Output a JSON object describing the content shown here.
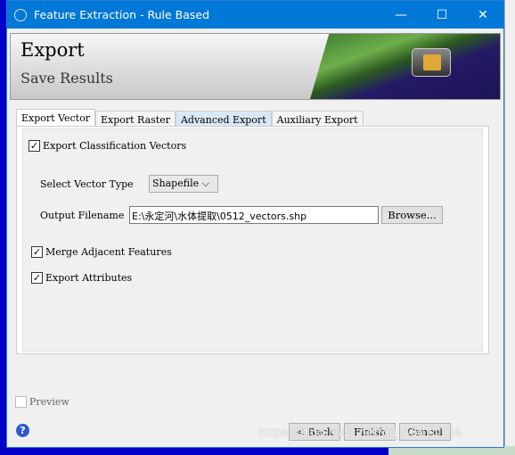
{
  "window": {
    "title": "Feature Extraction - Rule Based",
    "minimize": "—",
    "maximize": "☐",
    "close": "✕"
  },
  "banner": {
    "title": "Export",
    "subtitle": "Save Results"
  },
  "tabs": [
    {
      "label": "Export Vector",
      "active": true
    },
    {
      "label": "Export Raster"
    },
    {
      "label": "Advanced Export"
    },
    {
      "label": "Auxiliary Export"
    }
  ],
  "form": {
    "export_classification_vectors": {
      "label": "Export Classification Vectors",
      "checked": true
    },
    "vector_type": {
      "label": "Select Vector Type",
      "value": "Shapefile ⌵"
    },
    "output_filename": {
      "label": "Output Filename",
      "value": "E:\\永定河\\水体提取\\0512_vectors.shp",
      "browse": "Browse..."
    },
    "merge_adjacent": {
      "label": "Merge Adjacent Features",
      "checked": true
    },
    "export_attributes": {
      "label": "Export Attributes",
      "checked": true
    }
  },
  "preview": {
    "label": "Preview",
    "checked": false
  },
  "buttons": {
    "back": "< Back",
    "finish": "Finish",
    "cancel": "Cancel",
    "help": "?"
  },
  "watermark": "https://blog.csdn.net/qq_46071146"
}
